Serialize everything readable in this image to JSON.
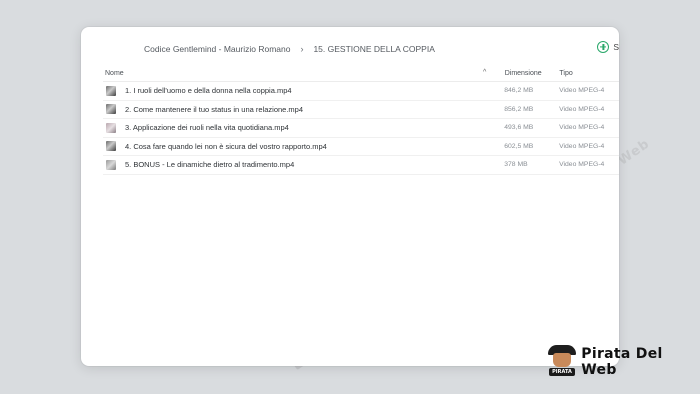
{
  "breadcrumb": {
    "root": "Codice Gentlemind - Maurizio Romano",
    "current": "15. GESTIONE DELLA COPPIA"
  },
  "add_button": {
    "label": "S",
    "icon": "plus-circle-icon",
    "color": "#2aa86a"
  },
  "table": {
    "columns": {
      "name": "Nome",
      "size": "Dimensione",
      "type": "Tipo"
    },
    "sort_indicator": "^",
    "rows": [
      {
        "name": "1. I ruoli dell'uomo e della donna nella coppia.mp4",
        "size": "846,2 MB",
        "type": "Video MPEG-4"
      },
      {
        "name": "2. Come mantenere il tuo status in una relazione.mp4",
        "size": "856,2 MB",
        "type": "Video MPEG-4"
      },
      {
        "name": "3. Applicazione dei ruoli nella vita quotidiana.mp4",
        "size": "493,6 MB",
        "type": "Video MPEG-4"
      },
      {
        "name": "4. Cosa fare quando lei non è sicura del vostro rapporto.mp4",
        "size": "602,5 MB",
        "type": "Video MPEG-4"
      },
      {
        "name": "5. BONUS - Le dinamiche dietro al tradimento.mp4",
        "size": "378 MB",
        "type": "Video MPEG-4"
      }
    ]
  },
  "watermark": {
    "text": "Pirata Del Web"
  },
  "logo": {
    "badge": "PIRATA",
    "text": "Pirata Del Web"
  }
}
